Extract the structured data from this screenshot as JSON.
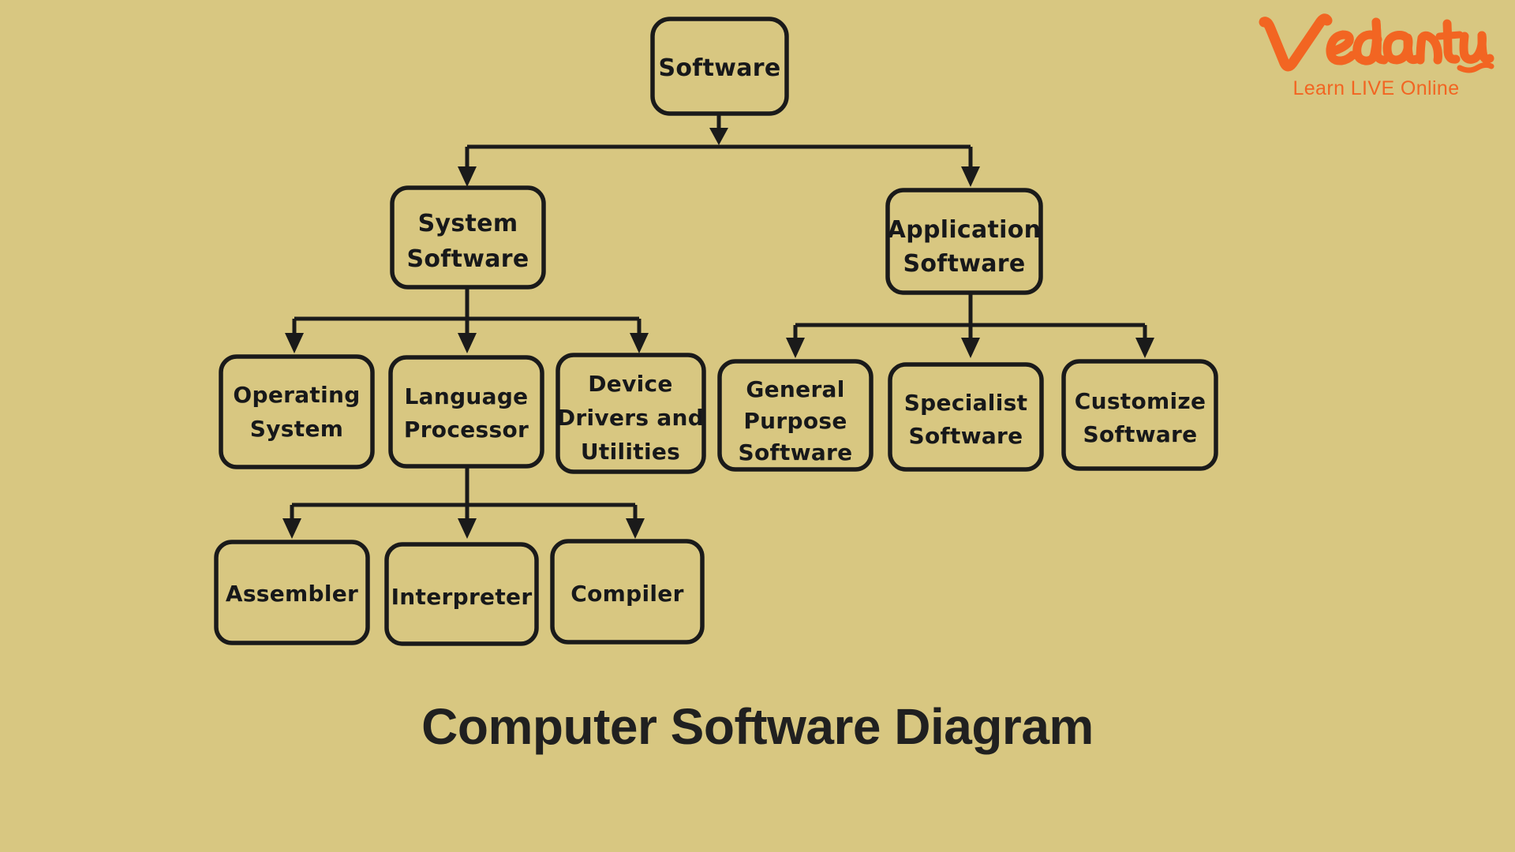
{
  "page": {
    "background_color": "#d8c781",
    "ink_color": "#1a1a1a",
    "caption": "Computer Software Diagram"
  },
  "brand": {
    "name": "Vedantu",
    "tagline": "Learn LIVE Online",
    "color": "#f26522",
    "logo_icon": "vedantu-script-wordmark"
  },
  "diagram": {
    "type": "tree",
    "title": "Computer Software Diagram",
    "style": "hand-drawn rounded rectangles with arrow connectors",
    "nodes": {
      "root": {
        "label": "Software"
      },
      "system": {
        "label_line1": "System",
        "label_line2": "Software"
      },
      "application": {
        "label_line1": "Application",
        "label_line2": "Software"
      },
      "os": {
        "label_line1": "Operating",
        "label_line2": "System"
      },
      "language_processor": {
        "label_line1": "Language",
        "label_line2": "Processor"
      },
      "device_drivers": {
        "label_line1": "Device",
        "label_line2": "Drivers and",
        "label_line3": "Utilities"
      },
      "general_purpose": {
        "label_line1": "General",
        "label_line2": "Purpose",
        "label_line3": "Software"
      },
      "specialist": {
        "label_line1": "Specialist",
        "label_line2": "Software"
      },
      "customize": {
        "label_line1": "Customize",
        "label_line2": "Software"
      },
      "assembler": {
        "label": "Assembler"
      },
      "interpreter": {
        "label": "Interpreter"
      },
      "compiler": {
        "label": "Compiler"
      }
    },
    "hierarchy": [
      {
        "parent": "Software",
        "children": [
          "System Software",
          "Application Software"
        ]
      },
      {
        "parent": "System Software",
        "children": [
          "Operating System",
          "Language Processor",
          "Device Drivers and Utilities"
        ]
      },
      {
        "parent": "Application Software",
        "children": [
          "General Purpose Software",
          "Specialist Software",
          "Customize Software"
        ]
      },
      {
        "parent": "Language Processor",
        "children": [
          "Assembler",
          "Interpreter",
          "Compiler"
        ]
      }
    ]
  }
}
